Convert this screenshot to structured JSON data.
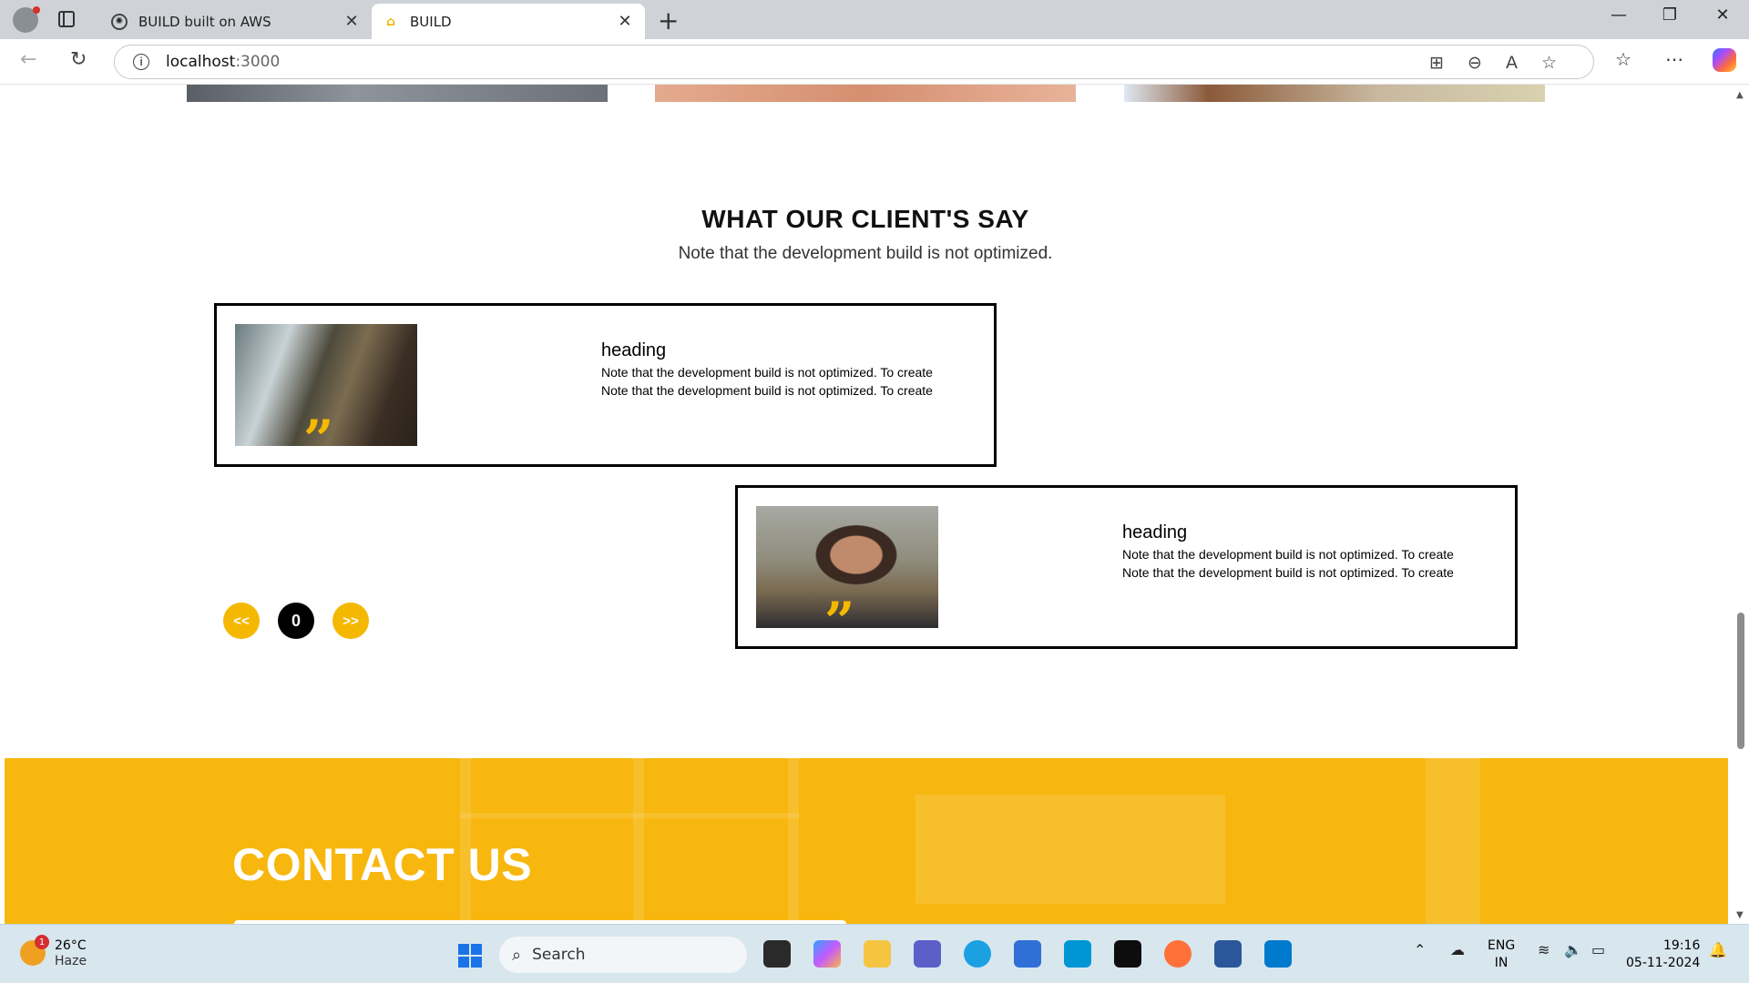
{
  "browser": {
    "tabs": [
      {
        "title": "BUILD built on AWS",
        "active": false
      },
      {
        "title": "BUILD",
        "active": true
      }
    ],
    "url_host": "localhost",
    "url_port": ":3000"
  },
  "page": {
    "section_title": "WHAT OUR CLIENT'S SAY",
    "section_subtitle": "Note that the development build is not optimized.",
    "testimonials": [
      {
        "heading": "heading",
        "line1": "Note that the development build is not optimized. To create",
        "line2": "Note that the development build is not optimized. To create"
      },
      {
        "heading": "heading",
        "line1": "Note that the development build is not optimized. To create",
        "line2": "Note that the development build is not optimized. To create"
      }
    ],
    "controls": {
      "prev": "<<",
      "indicator": "0",
      "next": ">>"
    },
    "contact_title": "CONTACT US",
    "accent_color": "#f5b800"
  },
  "taskbar": {
    "weather_temp": "26°C",
    "weather_desc": "Haze",
    "weather_badge": "1",
    "search_placeholder": "Search",
    "lang_top": "ENG",
    "lang_bottom": "IN",
    "time": "19:16",
    "date": "05-11-2024"
  }
}
